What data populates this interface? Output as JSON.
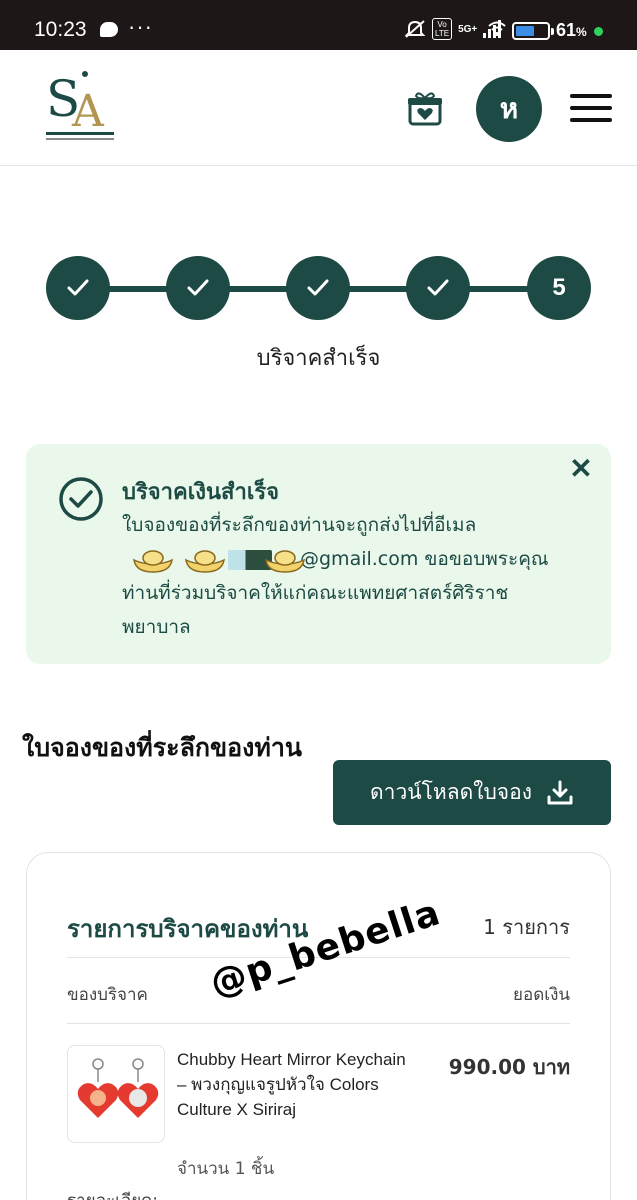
{
  "status_bar": {
    "time": "10:23",
    "more": "···",
    "volte": "Vo\nLTE",
    "network": "5G+",
    "battery_pct": "61",
    "battery_unit": "%",
    "battery_level": 0.61
  },
  "header": {
    "avatar_letter": "ห",
    "brand_color": "#1d4a45"
  },
  "stepper": {
    "steps": [
      {
        "state": "done",
        "label": ""
      },
      {
        "state": "done",
        "label": ""
      },
      {
        "state": "done",
        "label": ""
      },
      {
        "state": "done",
        "label": ""
      },
      {
        "state": "current",
        "label": "5"
      }
    ],
    "current_label": "บริจาคสำเร็จ"
  },
  "alert": {
    "title": "บริจาคเงินสำเร็จ",
    "line1": "ใบจองของที่ระลึกของท่านจะถูกส่งไปที่อีเมล",
    "email_suffix": "@gmail.com ขอขอบพระคุณ",
    "line3": "ท่านที่ร่วมบริจาคให้แก่คณะแพทยศาสตร์ศิริราช",
    "line4": "พยาบาล",
    "close": "✕",
    "bg_color": "#e9f8ea"
  },
  "voucher": {
    "heading": "ใบจองของที่ระลึกของท่าน",
    "download_label": "ดาวน์โหลดใบจอง"
  },
  "donation_card": {
    "title": "รายการบริจาคของท่าน",
    "count": "1 รายการ",
    "col_item": "ของบริจาค",
    "col_amount": "ยอดเงิน",
    "item_name": "Chubby Heart Mirror Keychain – พวงกุญแจรูปหัวใจ Colors Culture X Siriraj",
    "item_qty": "จำนวน 1 ชิ้น",
    "item_price": "990.00 บาท",
    "detail_label": "รายละเอียด:"
  },
  "watermark": "@p_bebella"
}
